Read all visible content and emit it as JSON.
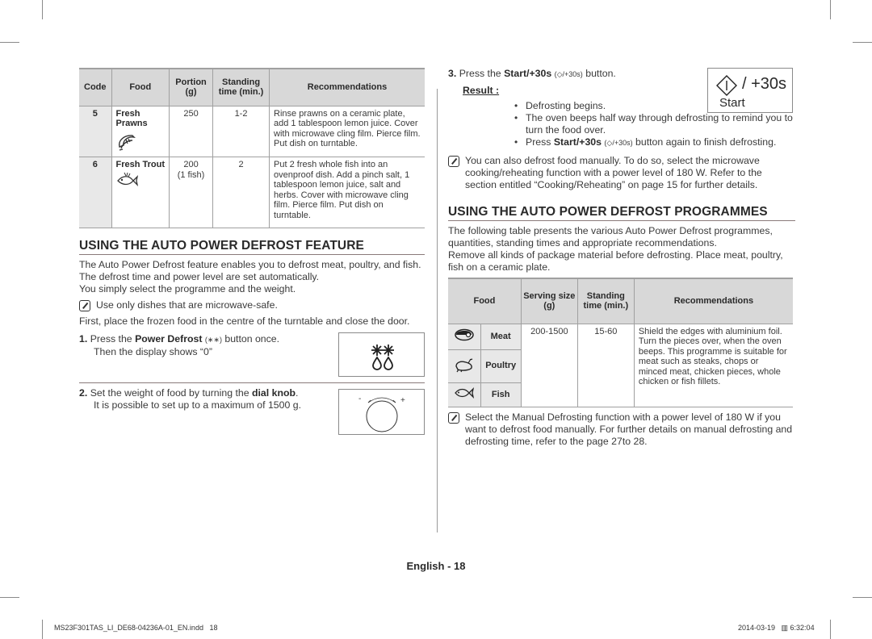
{
  "left": {
    "table1": {
      "headers": {
        "code": "Code",
        "food": "Food",
        "portion": "Portion (g)",
        "standing": "Standing time (min.)",
        "recommendations": "Recommendations"
      },
      "rows": [
        {
          "code": "5",
          "food": "Fresh Prawns",
          "icon": "prawn-icon",
          "portion": "250",
          "portion_note": "",
          "standing": "1-2",
          "recommendation": "Rinse prawns on a ceramic plate, add 1 tablespoon lemon juice. Cover with microwave cling film. Pierce film. Put dish on turntable."
        },
        {
          "code": "6",
          "food": "Fresh Trout",
          "icon": "fish-icon",
          "portion": "200",
          "portion_note": "(1 fish)",
          "standing": "2",
          "recommendation": "Put 2 fresh whole fish into an ovenproof dish. Add a pinch salt, 1 tablespoon lemon juice, salt and herbs. Cover with microwave cling film. Pierce film. Put dish on turntable."
        }
      ]
    },
    "section_title": "USING THE AUTO POWER DEFROST FEATURE",
    "intro_1": "The Auto Power Defrost feature enables you to defrost meat, poultry, and fish. The defrost time and power level are set automatically.",
    "intro_2": "You simply select the programme and the weight.",
    "note": "Use only dishes that are microwave-safe.",
    "first": "First, place the frozen food in the centre of the turntable and close the door.",
    "step1": {
      "num": "1.",
      "pre": "Press the ",
      "bold": "Power Defrost",
      "post": " button once.",
      "line2": "Then the display shows “0”"
    },
    "step2": {
      "num": "2.",
      "pre": "Set the weight of food by turning the ",
      "bold": "dial knob",
      "post": ".",
      "line2": "It is possible to set up to a maximum of 1500 g."
    },
    "dial": {
      "minus": "-",
      "plus": "+"
    }
  },
  "right": {
    "step3": {
      "num": "3.",
      "pre": "Press the ",
      "bold": "Start/+30s",
      "post": " button."
    },
    "result_label": "Result :",
    "bullets": [
      {
        "text": "Defrosting begins."
      },
      {
        "text": "The oven beeps half way through defrosting to remind you to turn the food over."
      },
      {
        "pre": "Press ",
        "bold": "Start/+30s",
        "post": " button again to finish defrosting."
      }
    ],
    "start_box": {
      "slash": "/ +30s",
      "label": "Start"
    },
    "note1": "You can also defrost food manually. To do so, select the microwave cooking/reheating function with a power level of 180 W. Refer to the section entitled “Cooking/Reheating” on page 15 for further details.",
    "section_title": "USING THE AUTO POWER DEFROST PROGRAMMES",
    "intro_1": "The following table presents the various Auto Power Defrost programmes, quantities, standing times and appropriate recommendations.",
    "intro_2": "Remove all kinds of package material before defrosting. Place meat, poultry, fish on a ceramic plate.",
    "table2": {
      "headers": {
        "food": "Food",
        "serving": "Serving size (g)",
        "standing": "Standing time (min.)",
        "recommendations": "Recommendations"
      },
      "rows": [
        {
          "icon": "meat-icon",
          "food": "Meat"
        },
        {
          "icon": "poultry-icon",
          "food": "Poultry"
        },
        {
          "icon": "fish-icon",
          "food": "Fish"
        }
      ],
      "serving": "200-1500",
      "standing": "15-60",
      "recommendation": "Shield the edges with aluminium foil. Turn the pieces over, when the oven beeps. This programme is suitable for meat such as steaks, chops or minced meat, chicken pieces, whole chicken or fish fillets."
    },
    "note2": "Select the Manual Defrosting function with a power level of 180 W if you want to defrost food manually. For further details on manual defrosting and defrosting time, refer to the page 27to 28."
  },
  "footer": {
    "page_label": "English - 18",
    "file_name": "MS23F301TAS_LI_DE68-04236A-01_EN.indd   18",
    "timestamp": "2014-03-19   ▥ 6:32:04"
  }
}
